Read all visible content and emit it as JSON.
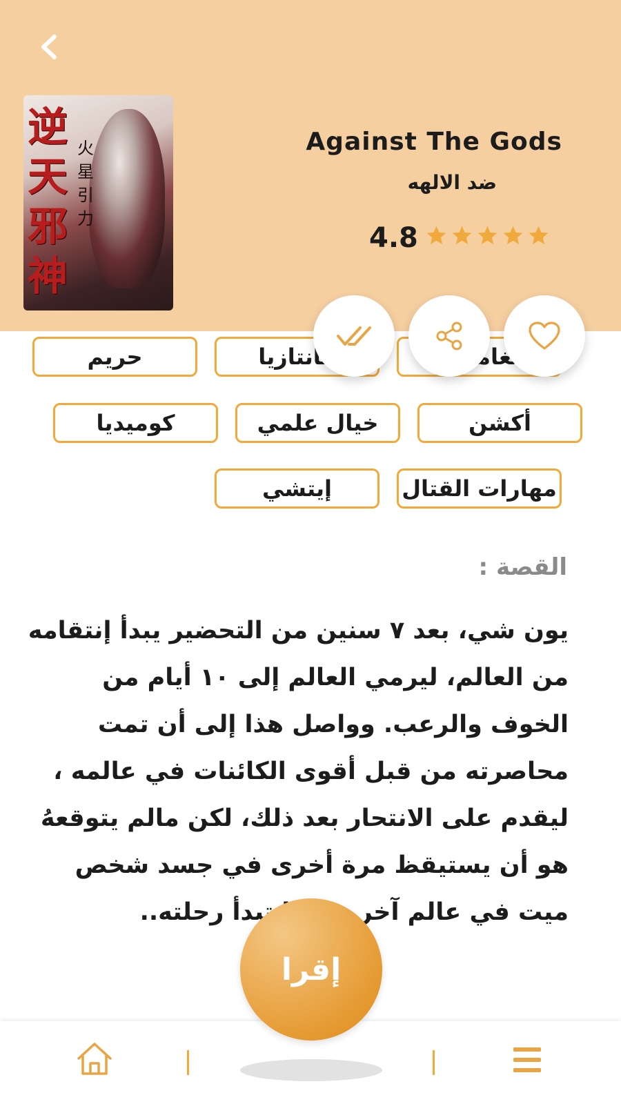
{
  "book": {
    "title_en": "Against The Gods",
    "title_ar": "ضد الالهه",
    "rating": "4.8",
    "stars": 5,
    "cover_chars_main": "逆天邪神",
    "cover_chars_sub": "火星引力"
  },
  "tags": [
    "حريم",
    "فانتازيا",
    "مغامرات",
    "كوميديا",
    "خيال علمي",
    "أكشن",
    "إيتشي",
    "مهارات القتال"
  ],
  "story": {
    "label": "القصة :",
    "text": "يون شي، بعد ٧ سنين من التحضير يبدأ إنتقامه من العالم، ليرمي العالم إلى ١٠ أيام من الخوف والرعب. وواصل هذا إلى أن تمت محاصرته من قبل أقوى الكائنات في عالمه ، ليقدم على الانتحار بعد ذلك، لكن مالم يتوقعهُ هو أن يستيقظ مرة أخرى في جسد شخص ميت في عالم آخر ، وهنا تبدأ رحلته.."
  },
  "actions": {
    "read_label": "إقرا"
  },
  "icons": {
    "back": "chevron-left-icon",
    "favorite": "heart-icon",
    "share": "share-icon",
    "mark_read": "double-check-icon",
    "home": "home-icon",
    "menu": "menu-icon"
  },
  "colors": {
    "header_bg": "#f5cfa0",
    "accent": "#f0a93a",
    "star": "#f0a93a"
  }
}
